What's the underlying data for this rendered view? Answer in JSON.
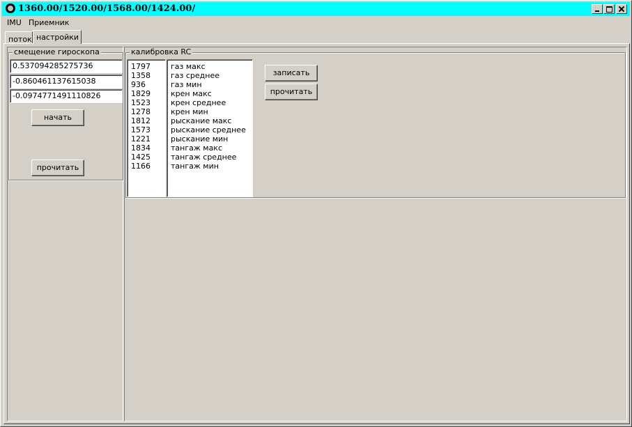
{
  "window": {
    "title": "1360.00/1520.00/1568.00/1424.00/",
    "icon": "app-icon",
    "controls": [
      "minimize-icon",
      "maximize-icon",
      "close-icon"
    ]
  },
  "menu": {
    "items": [
      {
        "label": "IMU"
      },
      {
        "label": "Приемник"
      }
    ]
  },
  "tabs": [
    {
      "label": "поток"
    },
    {
      "label": "настройки",
      "selected": true
    }
  ],
  "gyro_group": {
    "title": "смещение гироскопа",
    "fields": [
      {
        "value": "0.537094285275736"
      },
      {
        "value": "-0.860461137615038"
      },
      {
        "value": "-0.0974771491110826"
      }
    ],
    "start_label": "начать",
    "read_label": "прочитать"
  },
  "rc_group": {
    "title": "калибровка RC",
    "values": [
      "1797",
      "1358",
      "936",
      "1829",
      "1523",
      "1278",
      "1812",
      "1573",
      "1221",
      "1834",
      "1425",
      "1166"
    ],
    "names": [
      "газ макс",
      "газ среднее",
      "газ мин",
      "крен макс",
      "крен среднее",
      "крен мин",
      "рыскание макс",
      "рыскание среднее",
      "рыскание мин",
      "тангаж макс",
      "тангаж среднее",
      "тангаж мин"
    ],
    "write_label": "записать",
    "read_label": "прочитать"
  },
  "colors": {
    "titlebar": "#00ffff",
    "face": "#d4d0c8"
  }
}
